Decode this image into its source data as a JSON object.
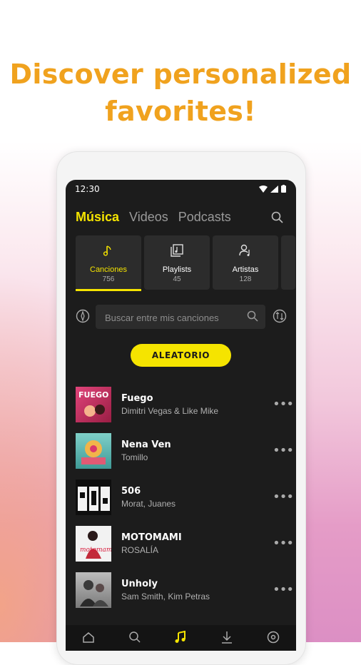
{
  "headline": {
    "line1": "Discover personalized",
    "line2": "favorites!"
  },
  "status": {
    "time": "12:30"
  },
  "tabs": [
    {
      "label": "Música",
      "active": true
    },
    {
      "label": "Videos",
      "active": false
    },
    {
      "label": "Podcasts",
      "active": false
    }
  ],
  "categories": [
    {
      "label": "Canciones",
      "count": "756",
      "icon": "music-note-icon"
    },
    {
      "label": "Playlists",
      "count": "45",
      "icon": "playlist-icon"
    },
    {
      "label": "Artistas",
      "count": "128",
      "icon": "artist-icon"
    }
  ],
  "search": {
    "placeholder": "Buscar entre mis canciones"
  },
  "shuffle": {
    "label": "ALEATORIO"
  },
  "songs": [
    {
      "title": "Fuego",
      "artist": "Dimitri Vegas & Like Mike",
      "art_color": "#d8356c"
    },
    {
      "title": "Nena Ven",
      "artist": "Tomillo",
      "art_color": "#5fb8b4"
    },
    {
      "title": "506",
      "artist": "Morat, Juanes",
      "art_color": "#111111"
    },
    {
      "title": "MOTOMAMI",
      "artist": "ROSALÍA",
      "art_color": "#f3f3f3"
    },
    {
      "title": "Unholy",
      "artist": "Sam Smith, Kim Petras",
      "art_color": "#9a9a9a"
    }
  ],
  "colors": {
    "accent": "#f5e400",
    "headline": "#f0a21e",
    "screen_bg": "#1c1c1c"
  }
}
